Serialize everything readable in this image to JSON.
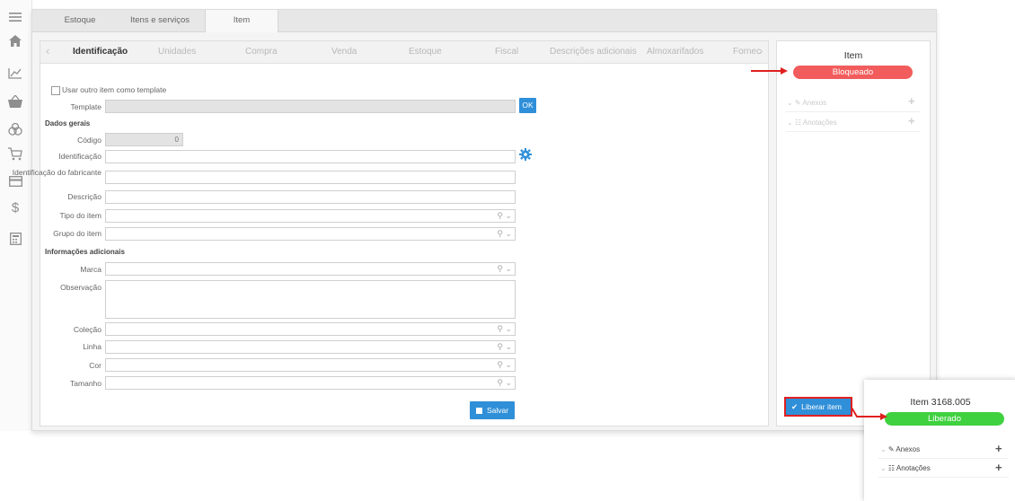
{
  "tabs": [
    {
      "label": "Estoque",
      "active": false
    },
    {
      "label": "Itens e serviços",
      "active": false
    },
    {
      "label": "Item",
      "active": true
    }
  ],
  "subtabs": [
    {
      "label": "Identificação",
      "active": true
    },
    {
      "label": "Unidades",
      "active": false
    },
    {
      "label": "Compra",
      "active": false
    },
    {
      "label": "Venda",
      "active": false
    },
    {
      "label": "Estoque",
      "active": false
    },
    {
      "label": "Fiscal",
      "active": false
    },
    {
      "label": "Descrições adicionais",
      "active": false
    },
    {
      "label": "Almoxarifados",
      "active": false
    },
    {
      "label": "Fornec",
      "active": false
    }
  ],
  "form": {
    "template_checkbox_label": "Usar outro item como template",
    "template_label": "Template",
    "ok_label": "OK",
    "section_general": "Dados gerais",
    "codigo_label": "Código",
    "codigo_value": "0",
    "identificacao_label": "Identificação",
    "fabricante_label": "Identificação do fabricante",
    "descricao_label": "Descrição",
    "tipo_label": "Tipo do item",
    "grupo_label": "Grupo do item",
    "section_additional": "Informações adicionais",
    "marca_label": "Marca",
    "observacao_label": "Observação",
    "colecao_label": "Coleção",
    "linha_label": "Linha",
    "cor_label": "Cor",
    "tamanho_label": "Tamanho",
    "save_label": "Salvar"
  },
  "side_panel": {
    "title": "Item",
    "status": "Bloqueado",
    "status_color": "#f25c5c",
    "anexos_label": "Anexos",
    "anotacoes_label": "Anotações",
    "release_label": "Liberar item"
  },
  "popup": {
    "title": "Item 3168.005",
    "status": "Liberado",
    "status_color": "#3fd13f",
    "anexos_label": "Anexos",
    "anotacoes_label": "Anotações"
  },
  "colors": {
    "accent": "#2f8fd8",
    "annotation_arrow": "#e02020"
  },
  "icons": [
    "menu-icon",
    "home-icon",
    "chart-icon",
    "basket-icon",
    "people-icon",
    "cart-icon",
    "card-icon",
    "dollar-icon",
    "calculator-icon",
    "search-icon",
    "chevron-down-icon",
    "gear-icon",
    "save-icon",
    "check-icon",
    "paperclip-icon",
    "notes-icon",
    "plus-icon"
  ]
}
